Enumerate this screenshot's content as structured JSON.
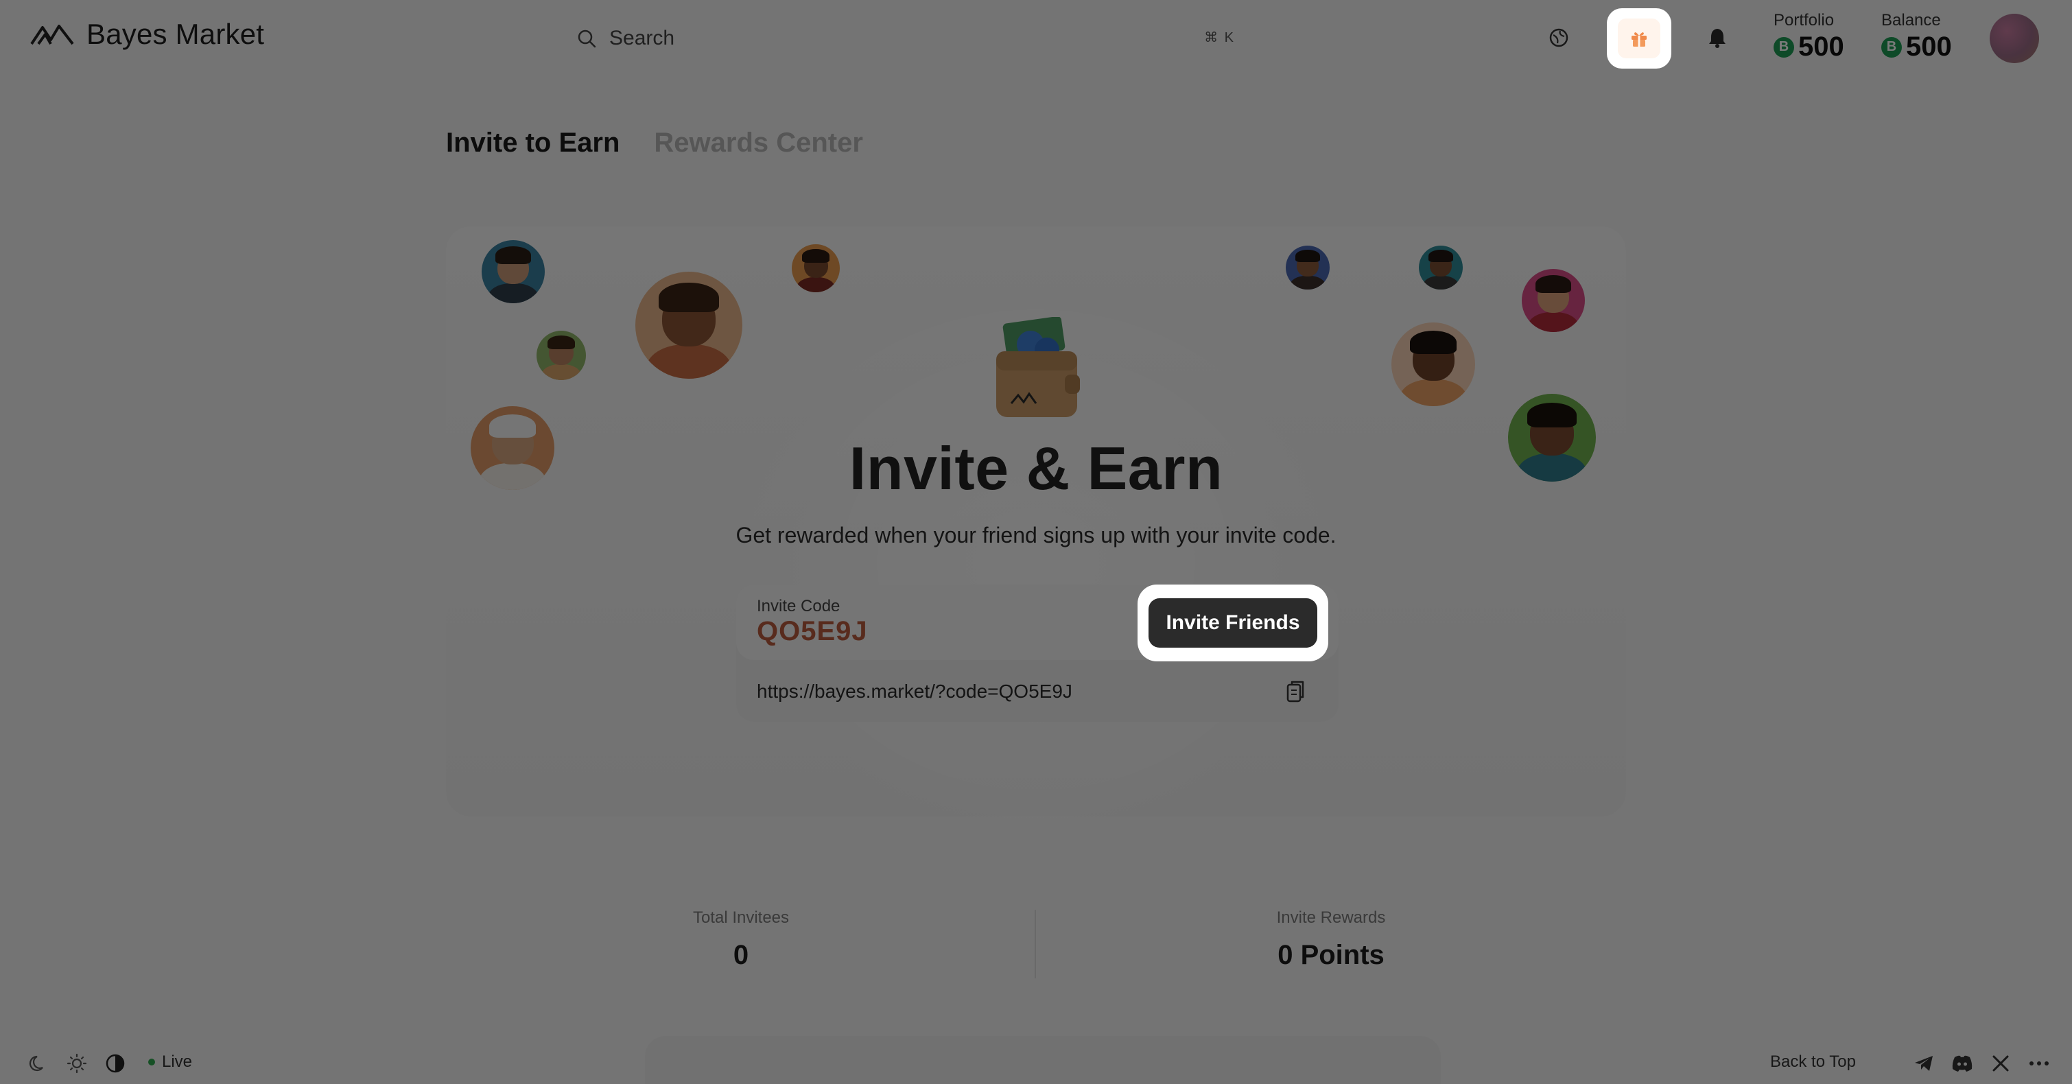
{
  "header": {
    "logo_text": "Bayes Market",
    "search_placeholder": "Search",
    "search_shortcut": "⌘ K",
    "portfolio_label": "Portfolio",
    "portfolio_value": "500",
    "balance_label": "Balance",
    "balance_value": "500",
    "currency_symbol": "B",
    "icons": [
      "logo-mountain-icon",
      "search-icon",
      "globe-icon",
      "gift-icon",
      "bell-icon",
      "user-avatar"
    ]
  },
  "tabs": [
    {
      "label": "Invite to Earn",
      "active": true
    },
    {
      "label": "Rewards Center",
      "active": false
    }
  ],
  "hero": {
    "title": "Invite & Earn",
    "subtitle": "Get rewarded when your friend signs up with your invite code."
  },
  "invite": {
    "code_label": "Invite Code",
    "code_value": "QO5E9J",
    "button_label": "Invite Friends",
    "link": "https://bayes.market/?code=QO5E9J"
  },
  "stats": {
    "invitees_label": "Total Invitees",
    "invitees_value": "0",
    "rewards_label": "Invite Rewards",
    "rewards_value": "0 Points"
  },
  "footer": {
    "live_label": "Live",
    "back_to_top": "Back to Top",
    "icons": [
      "moon-icon",
      "sun-icon",
      "contrast-icon",
      "telegram-icon",
      "discord-icon",
      "x-icon",
      "more-icon"
    ]
  },
  "colors": {
    "accent_code": "#b85b3e",
    "coin": "#1f9c55",
    "button": "#2b2b2b",
    "live": "#2fa84f"
  }
}
